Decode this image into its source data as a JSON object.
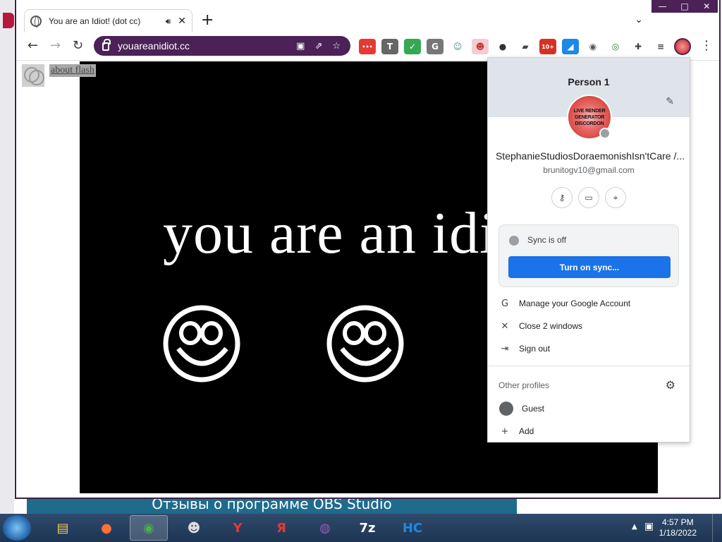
{
  "browser": {
    "tab_title": "You are an Idiot! (dot cc)",
    "tab_audio_icon": "speaker-icon",
    "tab_close": "✕",
    "new_tab": "+",
    "tab_search": "⌄",
    "window_controls": [
      "—",
      "□",
      "✕"
    ],
    "url": "youareanidiot.cc",
    "nav": {
      "back": "←",
      "forward": "→",
      "reload": "↻"
    },
    "menu": "⋮"
  },
  "extensions": [
    {
      "name": "ext-red-chat",
      "label": "•••",
      "bg": "#e53935",
      "color": "#fff"
    },
    {
      "name": "ext-t",
      "label": "T",
      "bg": "#666666",
      "color": "#fff"
    },
    {
      "name": "ext-green",
      "label": "✓",
      "bg": "#34a853",
      "color": "#fff"
    },
    {
      "name": "ext-g",
      "label": "G",
      "bg": "#777777",
      "color": "#fff"
    },
    {
      "name": "ext-cat",
      "label": "☺",
      "bg": "#ffffff",
      "color": "#4a8c8c"
    },
    {
      "name": "ext-pink",
      "label": "☻",
      "bg": "#f6cbd5",
      "color": "#c0392b"
    },
    {
      "name": "ext-speech",
      "label": "●",
      "bg": "#ffffff",
      "color": "#333"
    },
    {
      "name": "ext-comment",
      "label": "▰",
      "bg": "#ffffff",
      "color": "#444"
    },
    {
      "name": "ext-badge",
      "label": "10+",
      "bg": "#d93025",
      "color": "#fff"
    },
    {
      "name": "ext-blue",
      "label": "◢",
      "bg": "#1e88e5",
      "color": "#fff"
    },
    {
      "name": "ext-twitch",
      "label": "◉",
      "bg": "#ffffff",
      "color": "#555"
    },
    {
      "name": "ext-pin",
      "label": "◎",
      "bg": "#ffffff",
      "color": "#2e7d32"
    },
    {
      "name": "ext-puzzle",
      "label": "✚",
      "bg": "#ffffff",
      "color": "#444"
    },
    {
      "name": "ext-media",
      "label": "≡",
      "bg": "#ffffff",
      "color": "#444"
    }
  ],
  "page": {
    "flash_link": "about flash",
    "headline": "you are an idiot"
  },
  "profile": {
    "person": "Person 1",
    "avatar_lines": [
      "LIVE RENDER",
      "GENERATOR",
      "DISCORDON"
    ],
    "name": "StephanieStudiosDoraemonishIsn'tCare /...",
    "email": "brunitogv10@gmail.com",
    "sync_status": "Sync is off",
    "sync_button": "Turn on sync...",
    "menu_items": [
      {
        "icon": "G",
        "label": "Manage your Google Account"
      },
      {
        "icon": "✕",
        "label": "Close 2 windows"
      },
      {
        "icon": "⇥",
        "label": "Sign out"
      }
    ],
    "other_profiles_title": "Other profiles",
    "guest_label": "Guest",
    "add_label": "Add"
  },
  "background": {
    "banner_text": "Отзывы о программе OBS Studio"
  },
  "taskbar": {
    "apps": [
      {
        "name": "explorer-app",
        "label": "▤",
        "color": "#f2c94c"
      },
      {
        "name": "firefox-app",
        "label": "●",
        "color": "#ff7139"
      },
      {
        "name": "chrome-app",
        "label": "◉",
        "color": "#4caf50"
      },
      {
        "name": "raccoon-app",
        "label": "☻",
        "color": "#dddddd"
      },
      {
        "name": "yandex-browser-app",
        "label": "Y",
        "color": "#e53935"
      },
      {
        "name": "yandex-app",
        "label": "Я",
        "color": "#e53935"
      },
      {
        "name": "tor-app",
        "label": "◍",
        "color": "#9b59b6"
      },
      {
        "name": "7zip-app",
        "label": "7z",
        "color": "#ffffff"
      },
      {
        "name": "hc-app",
        "label": "HC",
        "color": "#1e88e5"
      }
    ],
    "time": "4:57 PM",
    "date": "1/18/2022",
    "tray_arrow": "▲"
  }
}
